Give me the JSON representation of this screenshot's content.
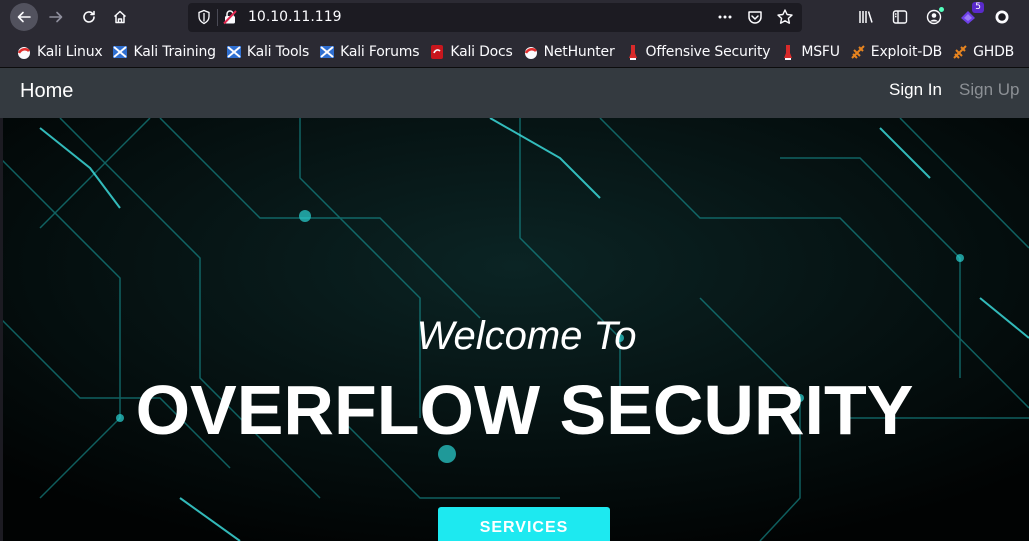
{
  "browser": {
    "url": "10.10.11.119",
    "extension_badge": "5",
    "colors": {
      "toolbar": "#2b2a33",
      "urlbar": "#1c1b22",
      "accent_badge": "#592acb"
    }
  },
  "bookmarks": [
    {
      "label": "Kali Linux",
      "icon": "kali-dragon-icon"
    },
    {
      "label": "Kali Training",
      "icon": "kali-training-icon"
    },
    {
      "label": "Kali Tools",
      "icon": "kali-tools-icon"
    },
    {
      "label": "Kali Forums",
      "icon": "kali-forums-icon"
    },
    {
      "label": "Kali Docs",
      "icon": "kali-docs-icon"
    },
    {
      "label": "NetHunter",
      "icon": "nethunter-icon"
    },
    {
      "label": "Offensive Security",
      "icon": "offsec-icon"
    },
    {
      "label": "MSFU",
      "icon": "msfu-icon"
    },
    {
      "label": "Exploit-DB",
      "icon": "exploit-db-icon"
    },
    {
      "label": "GHDB",
      "icon": "ghdb-icon"
    }
  ],
  "site_nav": {
    "home": "Home",
    "sign_in": "Sign In",
    "sign_up": "Sign Up"
  },
  "hero": {
    "subtitle": "Welcome To",
    "title": "OVERFLOW SECURITY",
    "button": "SERVICES",
    "accent": "#1de9f0"
  }
}
